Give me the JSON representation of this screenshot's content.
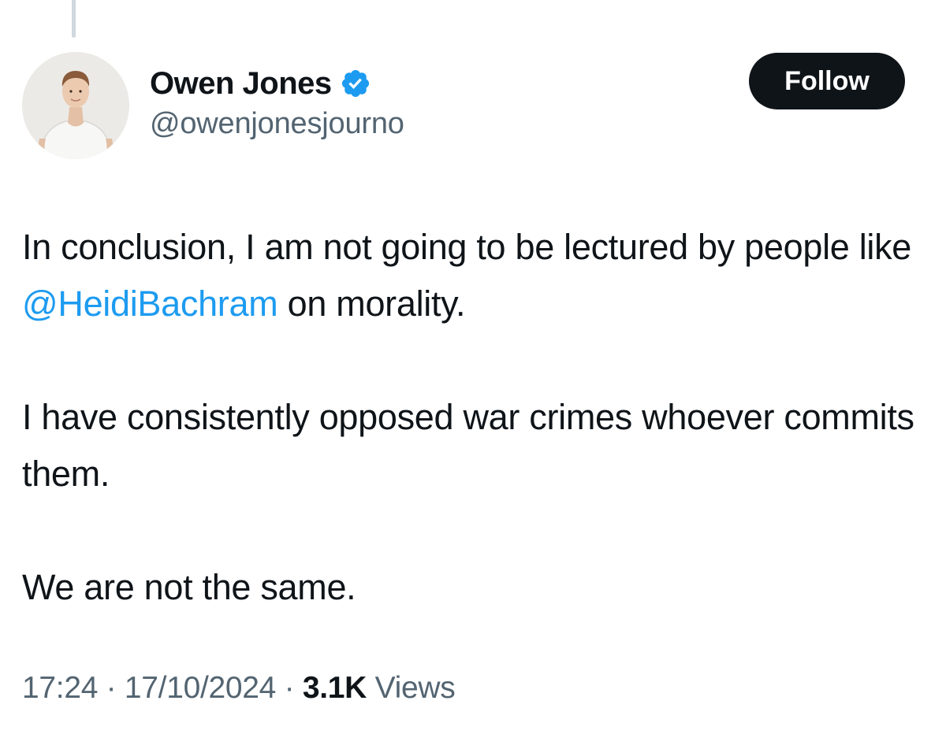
{
  "author": {
    "display_name": "Owen Jones",
    "handle": "@owenjonesjourno",
    "verified": true
  },
  "follow_button": {
    "label": "Follow"
  },
  "tweet": {
    "paragraph1_pre": "In conclusion, I am not going to be lectured by people like ",
    "mention": "@HeidiBachram",
    "paragraph1_post": " on morality.",
    "paragraph2": "I have consistently opposed war crimes whoever commits them.",
    "paragraph3": "We are not the same."
  },
  "meta": {
    "time": "17:24",
    "separator": " · ",
    "date": "17/10/2024",
    "views_count": "3.1K",
    "views_label": " Views"
  },
  "colors": {
    "accent": "#1d9bf0",
    "text": "#0f1419",
    "secondary": "#536471",
    "button_bg": "#0f1419"
  }
}
